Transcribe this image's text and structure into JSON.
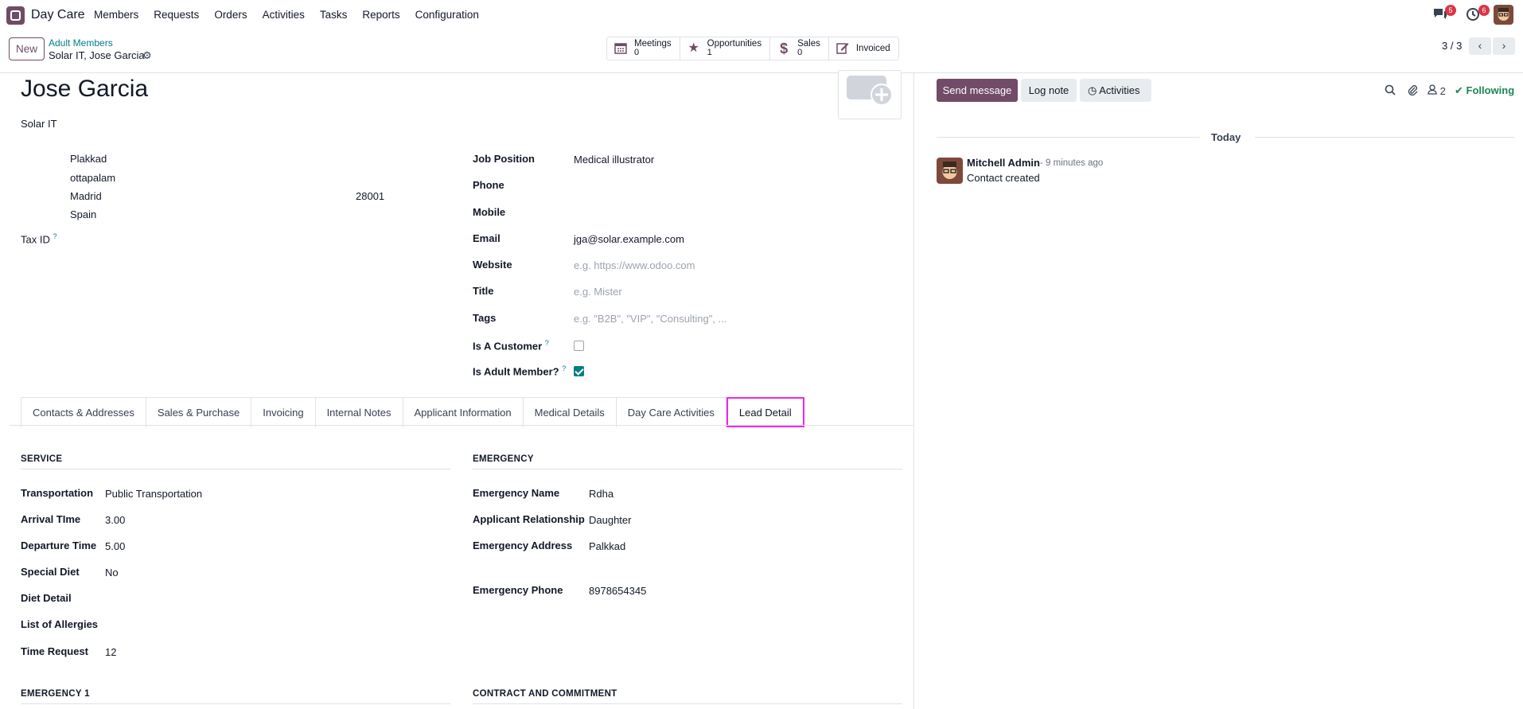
{
  "app": {
    "name": "Day Care"
  },
  "menu": [
    "Members",
    "Requests",
    "Orders",
    "Activities",
    "Tasks",
    "Reports",
    "Configuration"
  ],
  "systray": {
    "messages_count": "5",
    "activities_count": "6"
  },
  "control_panel": {
    "new_label": "New",
    "breadcrumb_parent": "Adult Members",
    "breadcrumb_current": "Solar IT, Jose Garcia",
    "pager": "3 / 3"
  },
  "smart_buttons": [
    {
      "label": "Meetings",
      "value": "0"
    },
    {
      "label": "Opportunities",
      "value": "1"
    },
    {
      "label": "Sales",
      "value": "0"
    },
    {
      "label": "Invoiced",
      "value": ""
    }
  ],
  "contact": {
    "name": "Jose Garcia",
    "company": "Solar IT",
    "street": "Plakkad",
    "street2": "ottapalam",
    "city": "Madrid",
    "zip": "28001",
    "country": "Spain",
    "tax_id_label": "Tax ID",
    "tax_id_help": "?"
  },
  "right_fields": {
    "job_position_label": "Job Position",
    "job_position": "Medical illustrator",
    "phone_label": "Phone",
    "mobile_label": "Mobile",
    "email_label": "Email",
    "email": "jga@solar.example.com",
    "website_label": "Website",
    "website_placeholder": "e.g. https://www.odoo.com",
    "title_label": "Title",
    "title_placeholder": "e.g. Mister",
    "tags_label": "Tags",
    "tags_placeholder": "e.g. \"B2B\", \"VIP\", \"Consulting\", ...",
    "is_customer_label": "Is A Customer",
    "is_customer": false,
    "is_adult_label": "Is Adult Member?",
    "is_adult": true,
    "help_mark": "?"
  },
  "tabs": [
    "Contacts & Addresses",
    "Sales & Purchase",
    "Invoicing",
    "Internal Notes",
    "Applicant Information",
    "Medical Details",
    "Day Care Activities",
    "Lead Detail"
  ],
  "active_tab": "Lead Detail",
  "service": {
    "title": "SERVICE",
    "transportation_label": "Transportation",
    "transportation": "Public Transportation",
    "arrival_label": "Arrival TIme",
    "arrival": "3.00",
    "departure_label": "Departure Time",
    "departure": "5.00",
    "special_diet_label": "Special Diet",
    "special_diet": "No",
    "diet_detail_label": "Diet Detail",
    "allergies_label": "List of Allergies",
    "time_request_label": "Time Request",
    "time_request": "12"
  },
  "emergency": {
    "title": "EMERGENCY",
    "name_label": "Emergency Name",
    "name": "Rdha",
    "relationship_label": "Applicant Relationship",
    "relationship": "Daughter",
    "address_label": "Emergency Address",
    "address": "Palkkad",
    "phone_label": "Emergency Phone",
    "phone": "8978654345"
  },
  "sections_bottom": {
    "left": "EMERGENCY 1",
    "right": "CONTRACT AND COMMITMENT"
  },
  "chatter": {
    "send_label": "Send message",
    "log_label": "Log note",
    "activities_label": "Activities",
    "followers_count": "2",
    "following_label": "Following",
    "today_label": "Today",
    "author": "Mitchell Admin",
    "time": "- 9 minutes ago",
    "body": "Contact created"
  },
  "colors": {
    "brand": "#714b67",
    "teal": "#017e84",
    "highlight": "#f026e8",
    "following": "#198754",
    "badge": "#dc3545"
  }
}
